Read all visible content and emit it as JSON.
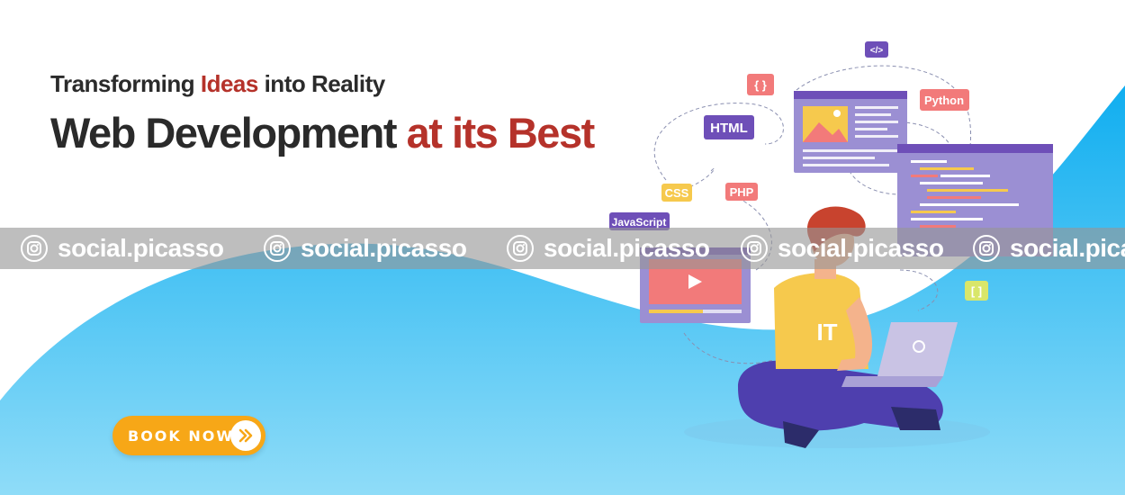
{
  "hero": {
    "eyebrow_pre": "Transforming ",
    "eyebrow_accent": "Ideas",
    "eyebrow_post": " into Reality",
    "headline_main": "Web Development ",
    "headline_accent": "at its Best"
  },
  "cta": {
    "label": "BOOK NOW",
    "icon": "double-chevron-right-icon"
  },
  "watermark": {
    "text": "social.picasso",
    "icon": "instagram-icon"
  },
  "illustration": {
    "tags": {
      "code": "</>",
      "braces": "{ }",
      "python": "Python",
      "html": "HTML",
      "css": "CSS",
      "php": "PHP",
      "javascript": "JavaScript",
      "brackets": "[ ]"
    },
    "shirt_text": "IT"
  },
  "colors": {
    "accent_red": "#b5322a",
    "headline_dark": "#2a2a2a",
    "wave_blue": "#1fb6f0",
    "button_orange": "#f7a717",
    "panel_purple": "#9b8fd3"
  }
}
